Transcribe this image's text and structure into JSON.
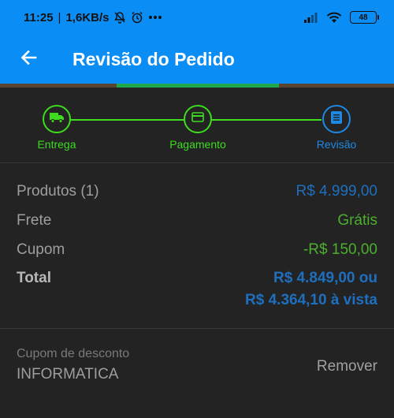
{
  "status_bar": {
    "time": "11:25",
    "network_speed": "1,6KB/s",
    "icons": [
      "bell-off-icon",
      "alarm-icon",
      "more-dots-icon",
      "signal-icon",
      "wifi-icon"
    ],
    "battery": "48"
  },
  "app_bar": {
    "back_icon": "arrow-left-icon",
    "title": "Revisão do Pedido"
  },
  "stepper": {
    "steps": [
      {
        "label": "Entrega",
        "icon": "truck-icon",
        "state": "done"
      },
      {
        "label": "Pagamento",
        "icon": "card-icon",
        "state": "done"
      },
      {
        "label": "Revisão",
        "icon": "document-icon",
        "state": "active"
      }
    ]
  },
  "summary": {
    "products": {
      "label": "Produtos (1)",
      "value": "R$ 4.999,00"
    },
    "shipping": {
      "label": "Frete",
      "value": "Grátis"
    },
    "coupon": {
      "label": "Cupom",
      "value": "-R$ 150,00"
    },
    "total": {
      "label": "Total",
      "value_line1": "R$ 4.849,00 ou",
      "value_line2": "R$ 4.364,10 à vista"
    }
  },
  "coupon_section": {
    "caption": "Cupom de desconto",
    "code": "INFORMATICA",
    "remove_label": "Remover"
  },
  "colors": {
    "app_bar": "#0a8df5",
    "background": "#232323",
    "step_done": "#3ddc1f",
    "step_active": "#1e88e5",
    "price_blue": "#1e6fbf",
    "free_green": "#4caf2f"
  }
}
